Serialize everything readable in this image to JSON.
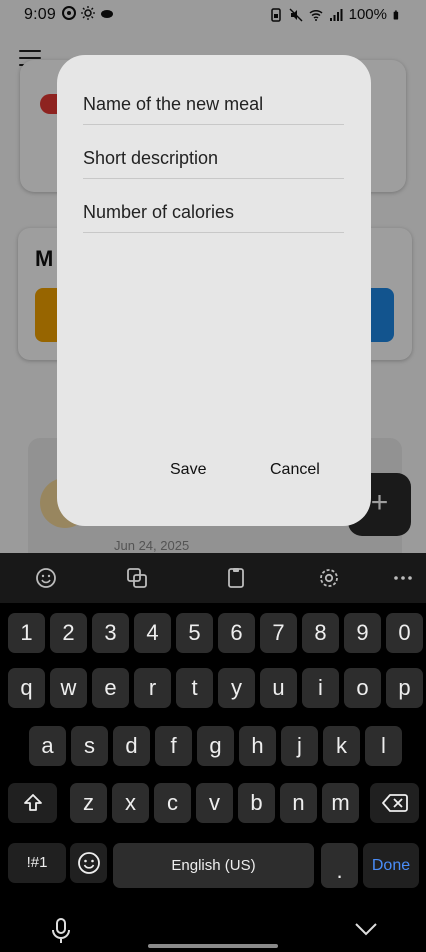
{
  "status_bar": {
    "time": "9:09",
    "battery": "100%"
  },
  "background": {
    "card2_title": "M",
    "meal_date": "Jun 24, 2025",
    "fab_label": "+"
  },
  "dialog": {
    "name_placeholder": "Name of the new meal",
    "description_placeholder": "Short description",
    "calories_placeholder": "Number of calories",
    "save_label": "Save",
    "cancel_label": "Cancel"
  },
  "keyboard": {
    "row_numbers": [
      "1",
      "2",
      "3",
      "4",
      "5",
      "6",
      "7",
      "8",
      "9",
      "0"
    ],
    "row1": [
      "q",
      "w",
      "e",
      "r",
      "t",
      "y",
      "u",
      "i",
      "o",
      "p"
    ],
    "row2": [
      "a",
      "s",
      "d",
      "f",
      "g",
      "h",
      "j",
      "k",
      "l"
    ],
    "row3": [
      "z",
      "x",
      "c",
      "v",
      "b",
      "n",
      "m"
    ],
    "symbols_label": "!#1",
    "space_label": "English (US)",
    "period_label": ".",
    "done_label": "Done"
  }
}
